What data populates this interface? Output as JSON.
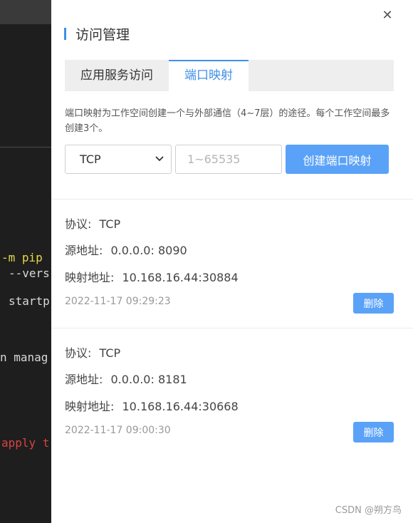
{
  "terminal": {
    "lines": [
      "-m pip",
      "--vers",
      "startp",
      "n manag",
      "apply t"
    ]
  },
  "drawer": {
    "title": "访问管理",
    "close_symbol": "✕",
    "tabs": [
      {
        "label": "应用服务访问",
        "active": false
      },
      {
        "label": "端口映射",
        "active": true
      }
    ],
    "description": "端口映射为工作空间创建一个与外部通信（4~7层）的途径。每个工作空间最多创建3个。",
    "form": {
      "protocol_value": "TCP",
      "port_placeholder": "1~65535",
      "create_label": "创建端口映射"
    },
    "labels": {
      "protocol": "协议:",
      "source": "源地址:",
      "mapped": "映射地址:"
    },
    "records": [
      {
        "protocol": "TCP",
        "source": "0.0.0.0: 8090",
        "mapped": "10.168.16.44:30884",
        "time": "2022-11-17 09:29:23",
        "delete_label": "删除"
      },
      {
        "protocol": "TCP",
        "source": "0.0.0.0: 8181",
        "mapped": "10.168.16.44:30668",
        "time": "2022-11-17 09:00:30",
        "delete_label": "删除"
      }
    ]
  },
  "watermark": "CSDN @朔方鸟",
  "colors": {
    "accent": "#3f8fe9",
    "button": "#5aa2f7"
  }
}
